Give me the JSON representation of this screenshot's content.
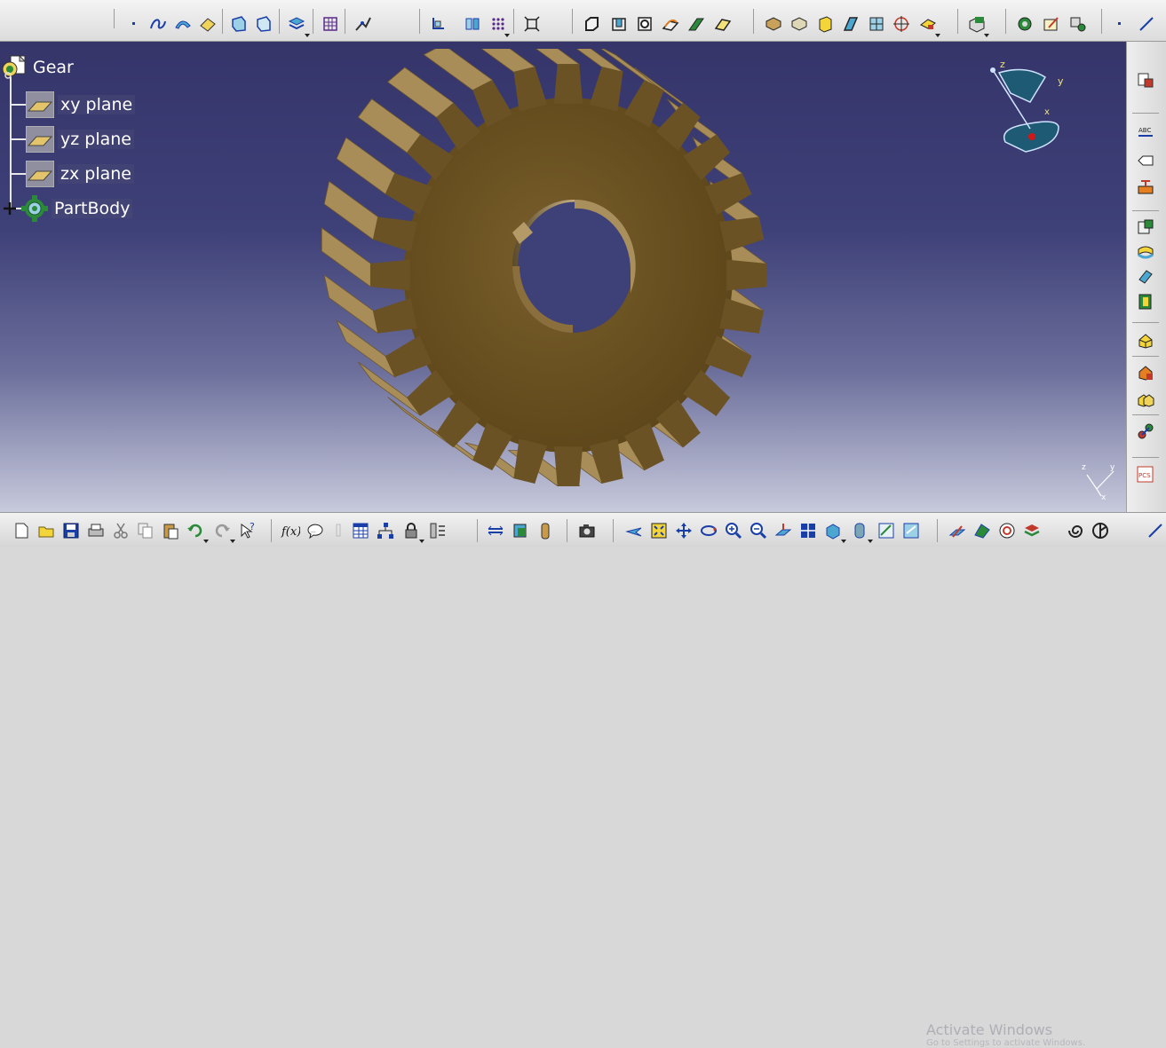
{
  "spec_tree": {
    "root": {
      "label": "Gear",
      "icon": "part-icon"
    },
    "children": [
      {
        "label": "xy plane",
        "icon": "plane-icon"
      },
      {
        "label": "yz plane",
        "icon": "plane-icon"
      },
      {
        "label": "zx plane",
        "icon": "plane-icon"
      },
      {
        "label": "PartBody",
        "icon": "body-gear-icon",
        "expandable": true
      }
    ]
  },
  "compass": {
    "axis_z": "z",
    "axis_y": "y",
    "axis_x": "x"
  },
  "mini_axis": {
    "axis_z": "z",
    "axis_y": "y",
    "axis_x": "x"
  },
  "watermark": {
    "title": "Activate Windows",
    "subtitle": "Go to Settings to activate Windows."
  },
  "colors": {
    "viewport_top": "#35356a",
    "viewport_bottom": "#c7c9dc",
    "gear_face": "#6e5626",
    "gear_teeth": "#a88d58",
    "tree_text": "#ffffff",
    "compass_fill": "#1e5a73"
  }
}
